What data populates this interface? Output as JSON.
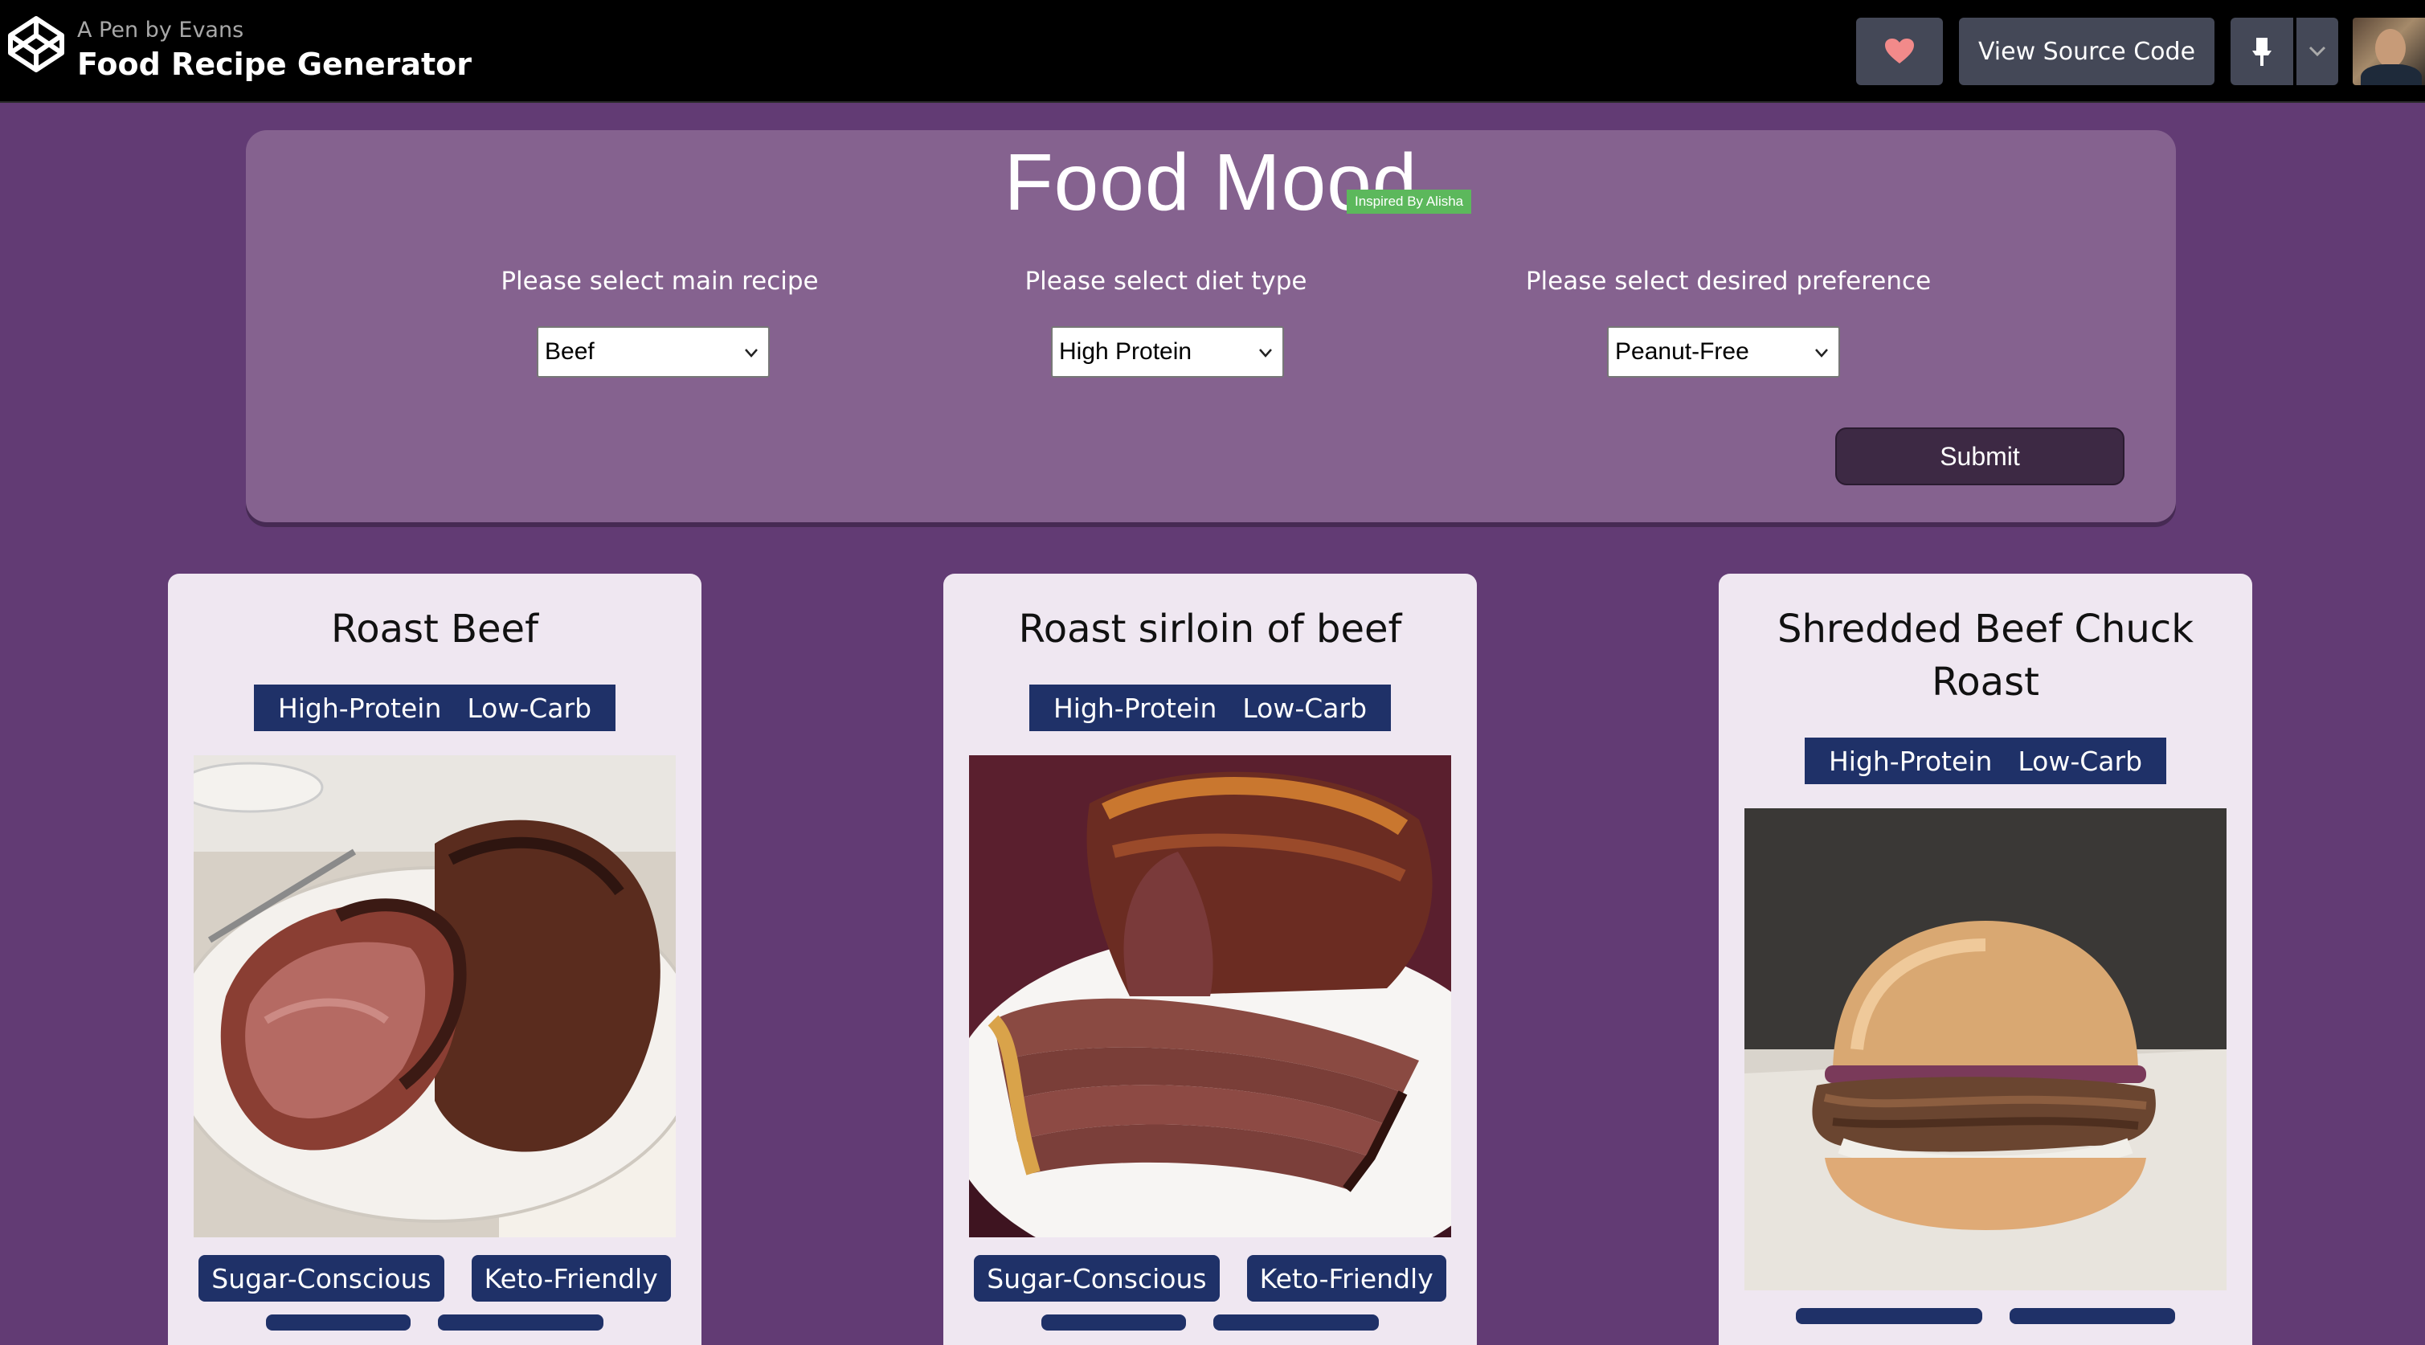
{
  "header": {
    "pen_by": "A Pen by Evans",
    "pen_title": "Food Recipe Generator",
    "source_label": "View Source Code",
    "heart_icon": "heart-icon",
    "pin_icon": "pin-icon",
    "caret_icon": "chevron-down-icon"
  },
  "form": {
    "title": "Food Mood",
    "badge": "Inspired By Alisha",
    "fields": [
      {
        "label": "Please select main recipe",
        "value": "Beef"
      },
      {
        "label": "Please select diet type",
        "value": "High Protein"
      },
      {
        "label": "Please select desired preference",
        "value": "Peanut-Free"
      }
    ],
    "submit_label": "Submit"
  },
  "recipes": [
    {
      "title": "Roast Beef",
      "diet_labels": [
        "High-Protein",
        "Low-Carb"
      ],
      "health_labels": [
        "Sugar-Conscious",
        "Keto-Friendly"
      ]
    },
    {
      "title": "Roast sirloin of beef",
      "diet_labels": [
        "High-Protein",
        "Low-Carb"
      ],
      "health_labels": [
        "Sugar-Conscious",
        "Keto-Friendly"
      ]
    },
    {
      "title": "Shredded Beef Chuck Roast",
      "title_line1": "Shredded Beef Chuck",
      "title_line2": "Roast",
      "diet_labels": [
        "High-Protein",
        "Low-Carb"
      ],
      "health_labels": []
    }
  ],
  "colors": {
    "page_bg": "#623b74",
    "panel_bg": "#85628f",
    "card_bg": "#efe7f1",
    "tag_bg": "#1f3168",
    "badge_bg": "#5cb85c",
    "submit_bg": "#3d2944",
    "heart": "#f28a8a"
  }
}
